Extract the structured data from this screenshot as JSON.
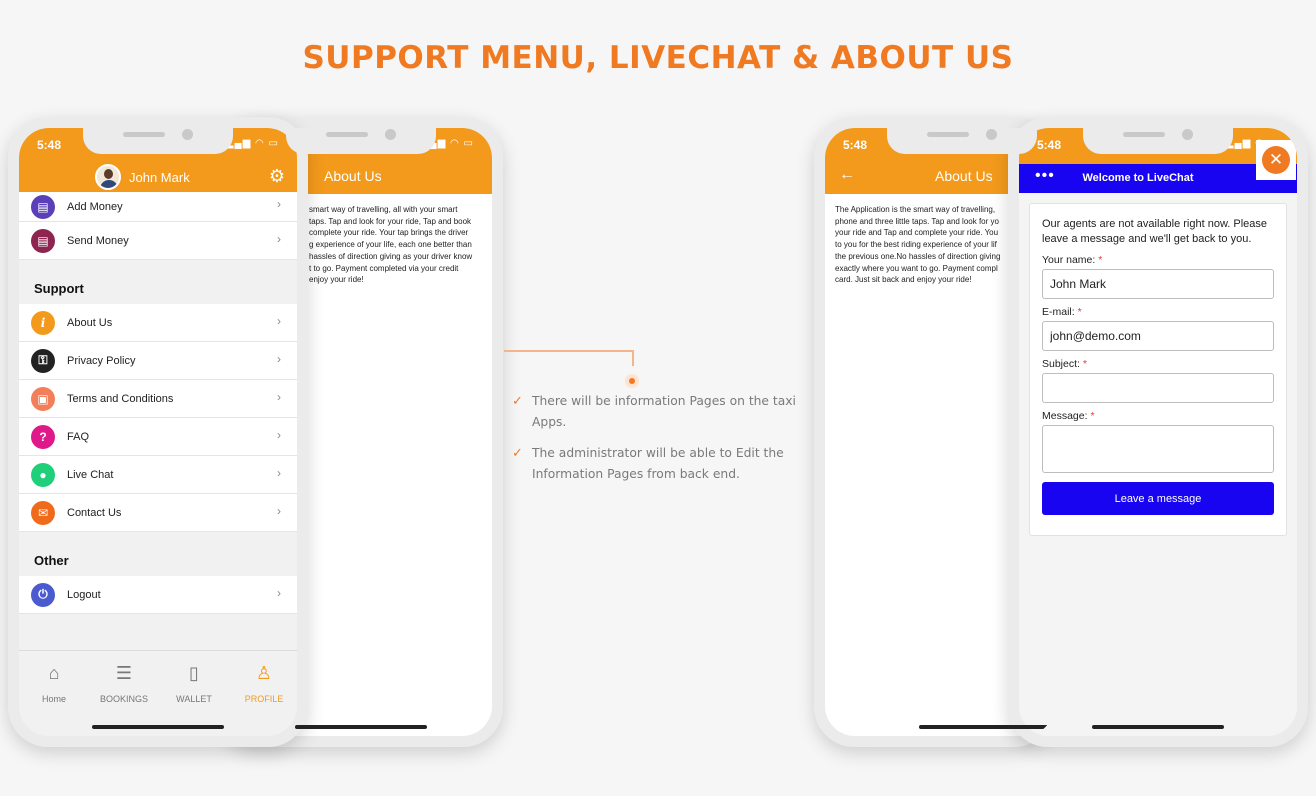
{
  "headline": "SUPPORT MENU, LIVECHAT & ABOUT US",
  "status_time": "5:48",
  "status_icons": "....",
  "profile": {
    "user_name": "John Mark",
    "items_top": [
      {
        "label": "Add Money",
        "icon": "wallet-plus-icon",
        "color": "#5b3fb8"
      },
      {
        "label": "Send Money",
        "icon": "wallet-send-icon",
        "color": "#8e2450"
      }
    ],
    "support_title": "Support",
    "support_items": [
      {
        "label": "About Us",
        "icon": "info-icon",
        "glyph": "i",
        "color": "#f39a1c"
      },
      {
        "label": "Privacy Policy",
        "icon": "lock-icon",
        "glyph": "🔒",
        "color": "#222222"
      },
      {
        "label": "Terms and Conditions",
        "icon": "padlock-icon",
        "glyph": "🔓",
        "color": "#f37f5a"
      },
      {
        "label": "FAQ",
        "icon": "question-icon",
        "glyph": "?",
        "color": "#e0198a"
      },
      {
        "label": "Live Chat",
        "icon": "chat-bubble-icon",
        "glyph": "💬",
        "color": "#1fcf7a"
      },
      {
        "label": "Contact Us",
        "icon": "mail-icon",
        "glyph": "✉",
        "color": "#f06a1c"
      }
    ],
    "other_title": "Other",
    "other_items": [
      {
        "label": "Logout",
        "icon": "power-icon",
        "glyph": "⏻",
        "color": "#4a5bd0"
      }
    ],
    "tabs": [
      {
        "label": "Home",
        "icon": "home-icon"
      },
      {
        "label": "BOOKINGS",
        "icon": "list-icon"
      },
      {
        "label": "WALLET",
        "icon": "wallet-icon"
      },
      {
        "label": "PROFILE",
        "icon": "user-icon",
        "active": true
      }
    ]
  },
  "about_left": {
    "title": "About Us",
    "lines": [
      "smart way of travelling, all with your smart",
      "taps. Tap and look for your ride, Tap and book",
      "complete your ride. Your tap brings the driver",
      "g experience of your life, each one better than",
      "hassles of direction giving as your driver know",
      "t to go. Payment completed via your credit",
      "enjoy your ride!"
    ]
  },
  "about_right": {
    "title": "About Us",
    "lines": [
      "The Application is the smart way of travelling,",
      "phone and three little taps. Tap and look for yo",
      "your ride and Tap and complete your ride. You",
      "to you for the best riding experience of your lif",
      "the previous one.No hassles of direction giving",
      "exactly where you want to go. Payment compl",
      "card. Just sit back and enjoy your ride!"
    ]
  },
  "livechat": {
    "title": "Welcome to LiveChat",
    "message": "Our agents are not available right now. Please leave a message and we'll get back to you.",
    "name_label": "Your name:",
    "name_value": "John Mark",
    "email_label": "E-mail:",
    "email_value": "john@demo.com",
    "subject_label": "Subject:",
    "subject_value": "",
    "message_label": "Message:",
    "message_value": "",
    "required_mark": "*",
    "button": "Leave a message"
  },
  "bullets": [
    "There will be information Pages on the taxi Apps.",
    "The administrator will be able to Edit the Information Pages from back end."
  ],
  "colors": {
    "accent": "#f07a22",
    "app_orange": "#f39a1c",
    "livechat_blue": "#1804f0"
  }
}
